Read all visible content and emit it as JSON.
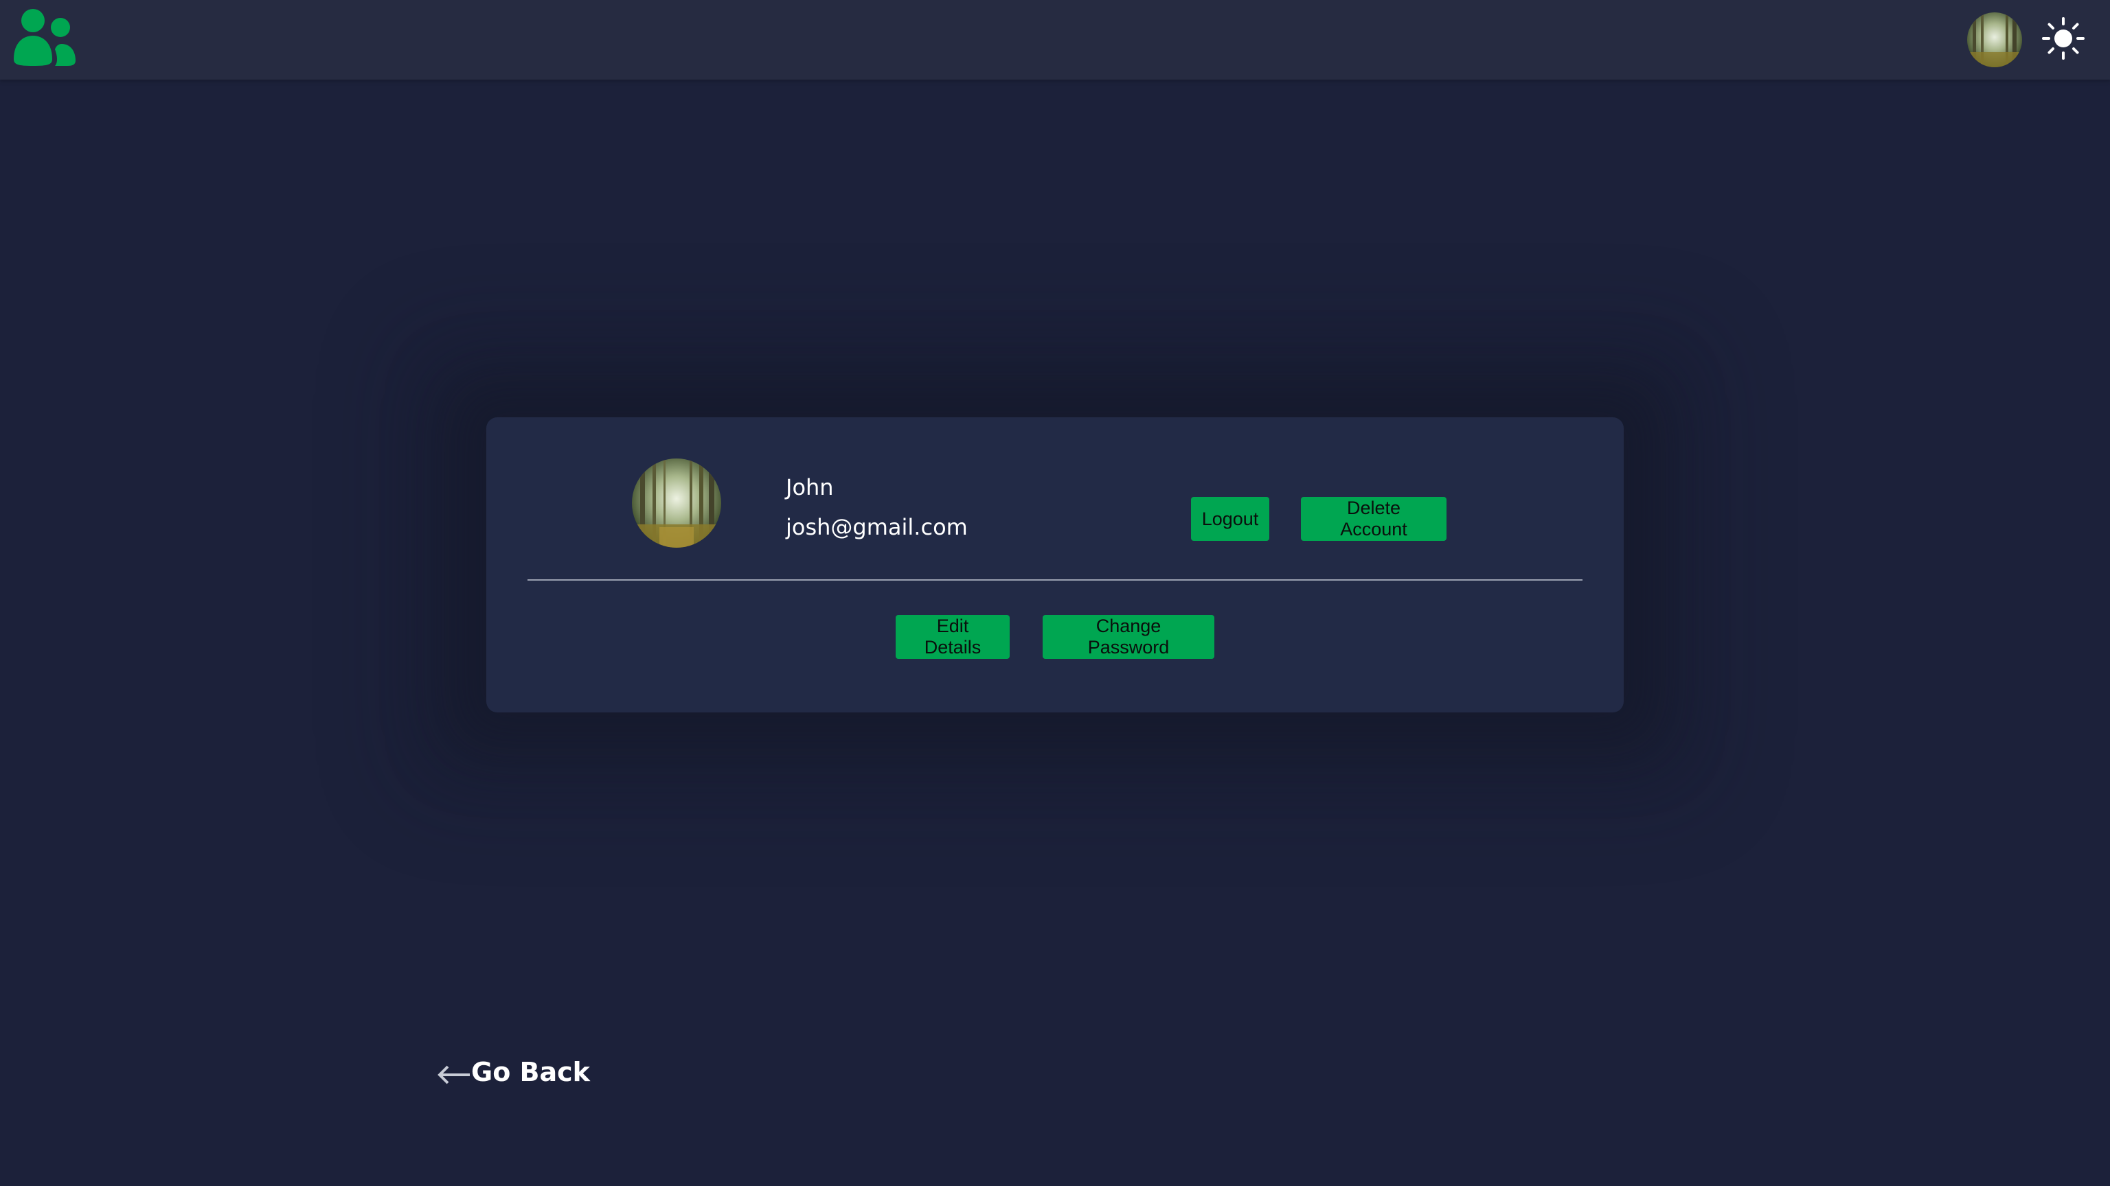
{
  "navbar": {
    "logo_icon": "users-group-icon",
    "avatar_icon": "forest-avatar",
    "theme_toggle_icon": "sun-icon"
  },
  "profile": {
    "name": "John",
    "email": "josh@gmail.com",
    "logout_label": "Logout",
    "delete_label": "Delete Account",
    "edit_label": "Edit Details",
    "change_password_label": "Change Password"
  },
  "footer": {
    "go_back_label": "Go Back",
    "go_back_icon": "arrow-left-icon"
  },
  "colors": {
    "background": "#1c213a",
    "navbar": "#262b41",
    "card": "#222a46",
    "accent": "#00a651",
    "text": "#ffffff"
  }
}
